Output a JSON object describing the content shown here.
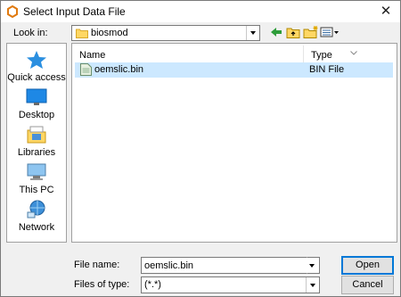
{
  "window": {
    "title": "Select Input Data File"
  },
  "look_in": {
    "label": "Look in:",
    "value": "biosmod"
  },
  "places": [
    {
      "label": "Quick access",
      "icon": "star-icon"
    },
    {
      "label": "Desktop",
      "icon": "desktop-icon"
    },
    {
      "label": "Libraries",
      "icon": "libraries-icon"
    },
    {
      "label": "This PC",
      "icon": "computer-icon"
    },
    {
      "label": "Network",
      "icon": "network-icon"
    }
  ],
  "columns": {
    "name": "Name",
    "type": "Type"
  },
  "files": [
    {
      "name": "oemslic.bin",
      "type": "BIN File"
    }
  ],
  "file_name": {
    "label": "File name:",
    "value": "oemslic.bin"
  },
  "file_type": {
    "label": "Files of type:",
    "value": "(*.*)"
  },
  "buttons": {
    "open": "Open",
    "cancel": "Cancel"
  },
  "colors": {
    "selection": "#cce8ff",
    "accent": "#0078d7",
    "folder": "#ffd764"
  }
}
